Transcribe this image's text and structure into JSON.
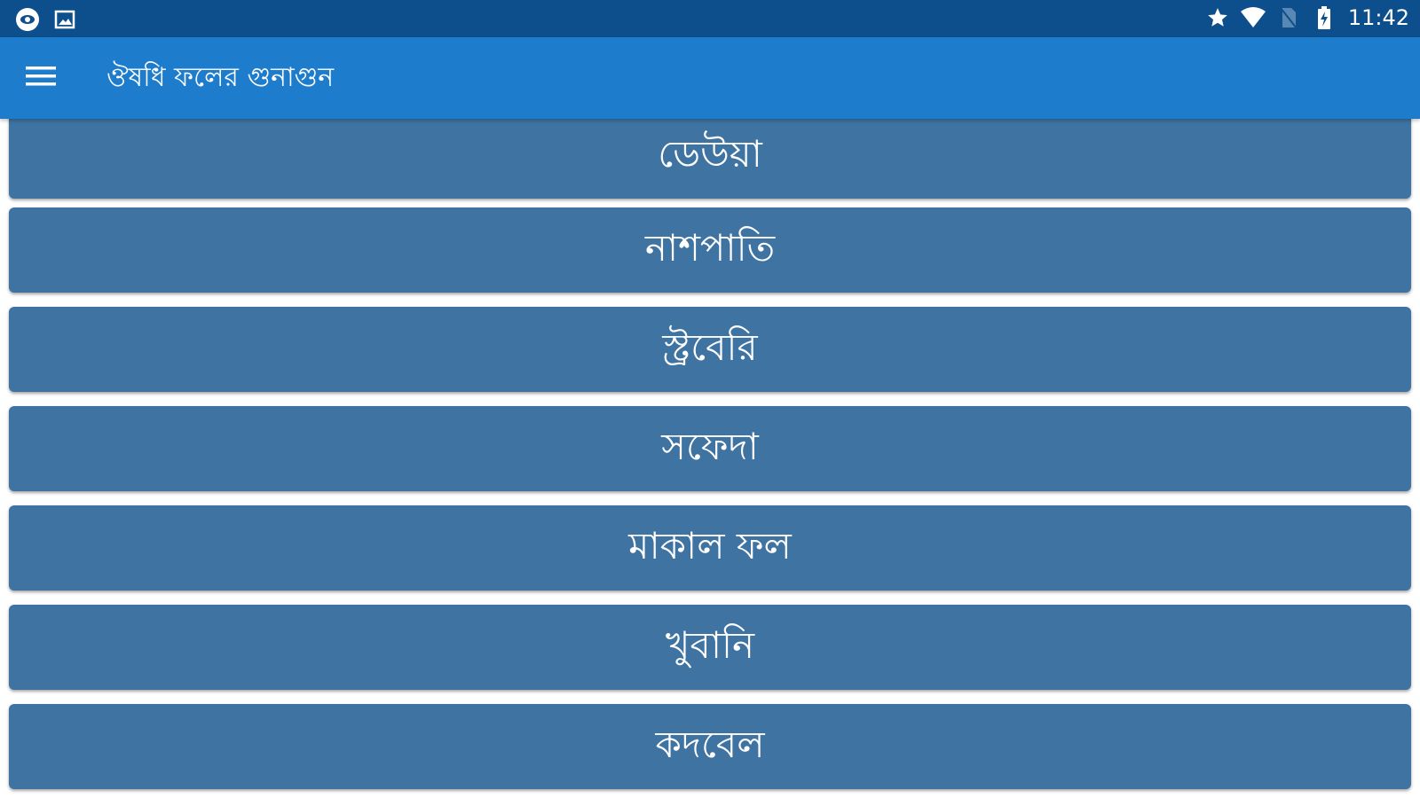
{
  "status_bar": {
    "left_icons": [
      "eye-icon",
      "image-icon"
    ],
    "right_icons": [
      "star-icon",
      "wifi-icon",
      "no-sim-icon",
      "battery-charging-icon"
    ],
    "time": "11:42"
  },
  "app_bar": {
    "menu_icon": "hamburger-menu-icon",
    "title": "ঔষধি ফলের গুনাগুন"
  },
  "fruit_list": {
    "items": [
      {
        "label": "ডেউয়া"
      },
      {
        "label": "নাশপাতি"
      },
      {
        "label": "স্ট্রবেরি"
      },
      {
        "label": "সফেদা"
      },
      {
        "label": "মাকাল  ফল"
      },
      {
        "label": "খুবানি"
      },
      {
        "label": "কদবেল"
      }
    ]
  },
  "colors": {
    "status_bar": "#0d4f8c",
    "app_bar": "#1e7ccd",
    "list_item": "#3f73a2",
    "text": "#ffffff"
  }
}
